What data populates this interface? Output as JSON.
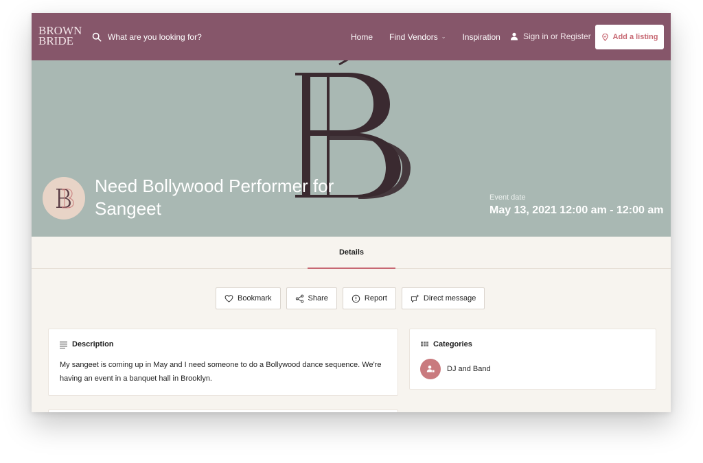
{
  "header": {
    "logo_line1": "BROWN",
    "logo_line2": "BRIDE",
    "search_placeholder": "What are you looking for?",
    "nav": [
      {
        "label": "Home"
      },
      {
        "label": "Find Vendors",
        "has_dropdown": true
      },
      {
        "label": "Inspiration"
      }
    ],
    "signin_label": "Sign in or Register",
    "add_listing_label": "Add a listing"
  },
  "hero": {
    "title": "Need Bollywood Performer for Sangeet",
    "event_label": "Event date",
    "event_date": "May 13, 2021 12:00 am - 12:00 am"
  },
  "tabs": [
    {
      "label": "Details",
      "active": true
    }
  ],
  "actions": [
    {
      "label": "Bookmark",
      "icon": "heart-icon"
    },
    {
      "label": "Share",
      "icon": "share-icon"
    },
    {
      "label": "Report",
      "icon": "alert-circle-icon"
    },
    {
      "label": "Direct message",
      "icon": "message-plus-icon"
    }
  ],
  "description": {
    "heading": "Description",
    "text": "My sangeet is coming up in May and I need someone to do a Bollywood dance sequence. We're having an event in a banquet hall in Brooklyn."
  },
  "categories": {
    "heading": "Categories",
    "items": [
      {
        "label": "DJ and Band",
        "icon": "user-group-icon"
      }
    ]
  },
  "colors": {
    "header_bg": "#86566a",
    "hero_bg": "#a9b8b3",
    "accent": "#c76873",
    "page_bg": "#f7f4ef",
    "logo_mark": "#3a2a30"
  }
}
